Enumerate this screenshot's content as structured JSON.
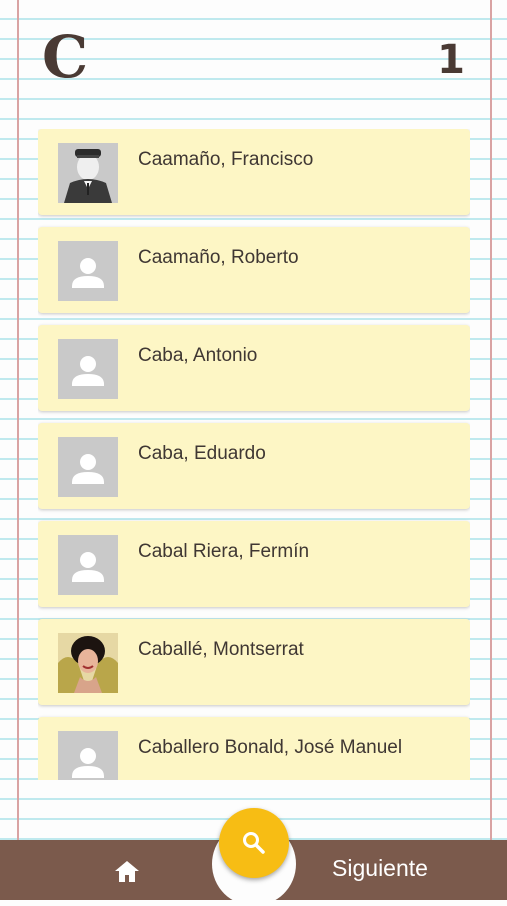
{
  "header": {
    "letter": "C",
    "page_number": "1"
  },
  "entries": [
    {
      "name": "Caamaño, Francisco",
      "photo": "portrait-photo"
    },
    {
      "name": "Caamaño, Roberto",
      "photo": "placeholder"
    },
    {
      "name": "Caba, Antonio",
      "photo": "placeholder"
    },
    {
      "name": "Caba, Eduardo",
      "photo": "placeholder"
    },
    {
      "name": "Cabal Riera, Fermín",
      "photo": "placeholder"
    },
    {
      "name": "Caballé, Montserrat",
      "photo": "portrait-photo"
    },
    {
      "name": "Caballero Bonald, José Manuel",
      "photo": "placeholder"
    }
  ],
  "bottom_bar": {
    "home_icon": "home-icon",
    "search_icon": "search-icon",
    "next_label": "Siguiente"
  },
  "colors": {
    "card_bg": "#fdf6c5",
    "bar_bg": "#7b5a4c",
    "fab_bg": "#f7bd14",
    "ruled_line": "#bfe9ee",
    "margin_line": "#d9a3a3",
    "heading_text": "#4a3a34"
  }
}
